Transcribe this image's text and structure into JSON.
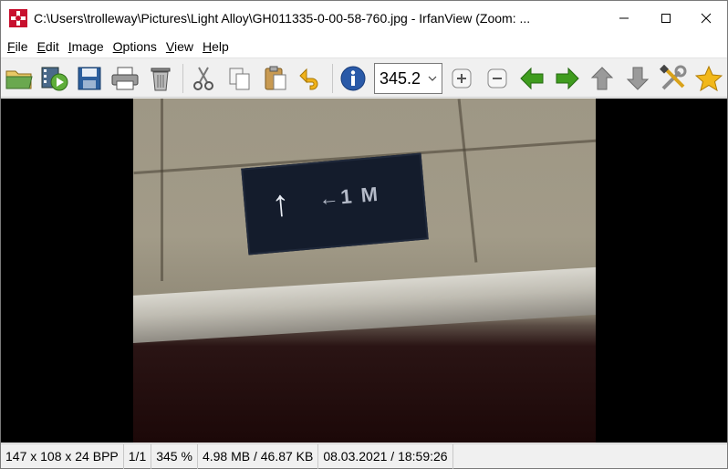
{
  "window": {
    "title": "C:\\Users\\trolleway\\Pictures\\Light Alloy\\GH011335-0-00-58-760.jpg - IrfanView (Zoom: ...",
    "app_icon": "irfanview-icon"
  },
  "menu": {
    "items": [
      {
        "label": "File",
        "underline": "F",
        "rest": "ile"
      },
      {
        "label": "Edit",
        "underline": "E",
        "rest": "dit"
      },
      {
        "label": "Image",
        "underline": "I",
        "rest": "mage"
      },
      {
        "label": "Options",
        "underline": "O",
        "rest": "ptions"
      },
      {
        "label": "View",
        "underline": "V",
        "rest": "iew"
      },
      {
        "label": "Help",
        "underline": "H",
        "rest": "elp"
      }
    ]
  },
  "toolbar": {
    "zoom_value": "345.2",
    "icons": [
      "open-folder-icon",
      "slideshow-icon",
      "save-icon",
      "print-icon",
      "delete-icon",
      "cut-icon",
      "copy-icon",
      "paste-icon",
      "undo-icon",
      "info-icon",
      "zoom-in-icon",
      "zoom-out-icon",
      "previous-icon",
      "next-icon",
      "up-icon",
      "down-icon",
      "settings-icon",
      "favorite-icon"
    ]
  },
  "image": {
    "sign_arrow": "↑",
    "sign_text": "←1 M"
  },
  "status": {
    "dimensions": "147 x 108 x 24 BPP",
    "page": "1/1",
    "zoom": "345 %",
    "size": "4.98 MB / 46.87 KB",
    "datetime": "08.03.2021 / 18:59:26"
  },
  "colors": {
    "green_arrow": "#3f9c1e",
    "gray_arrow": "#9a9a9a",
    "info_blue": "#2a5aa8",
    "star": "#f2b81a"
  }
}
